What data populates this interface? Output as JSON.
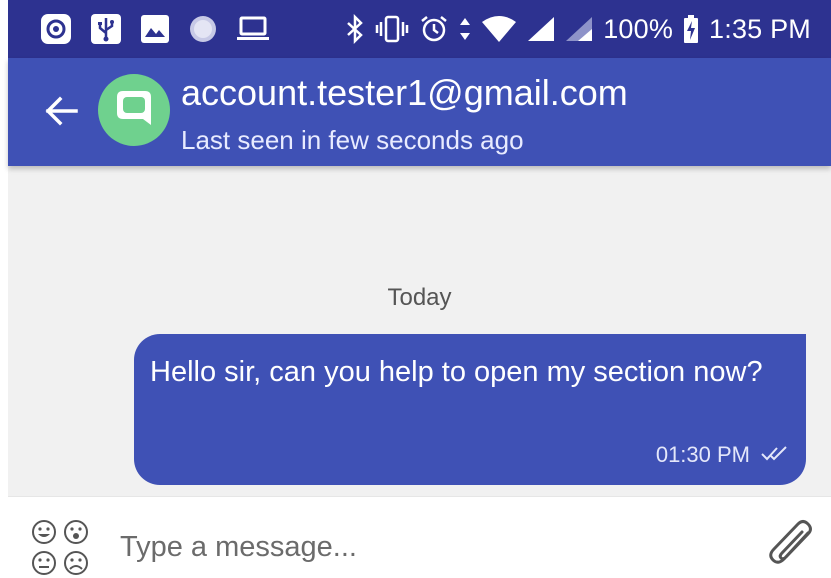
{
  "status_bar": {
    "battery": "100%",
    "time": "1:35 PM",
    "left_icons": [
      "camera-app-icon",
      "usb-icon",
      "image-icon",
      "circle-icon",
      "laptop-icon"
    ],
    "right_icons": [
      "bluetooth-icon",
      "vibrate-icon",
      "alarm-icon",
      "data-arrows-icon",
      "wifi-icon",
      "signal-icon",
      "signal-weak-icon",
      "battery-charging-icon"
    ]
  },
  "header": {
    "contact_name": "account.tester1@gmail.com",
    "contact_status": "Last seen in few seconds ago",
    "avatar_icon": "chat-bubble-icon",
    "back_icon": "arrow-left-icon"
  },
  "chat": {
    "date_divider": "Today",
    "messages": [
      {
        "text": "Hello sir, can you help to open my section now?",
        "time": "01:30 PM",
        "status_icon": "double-check-icon",
        "direction": "outgoing"
      }
    ]
  },
  "composer": {
    "placeholder": "Type a message...",
    "value": "",
    "emoji_icon": "emoji-faces-icon",
    "attach_icon": "paperclip-icon"
  },
  "colors": {
    "status_bar": "#2d3290",
    "app_bar": "#3f51b5",
    "avatar": "#6fd18e",
    "bubble": "#3f51b5",
    "chat_background": "#f1f1f1"
  }
}
